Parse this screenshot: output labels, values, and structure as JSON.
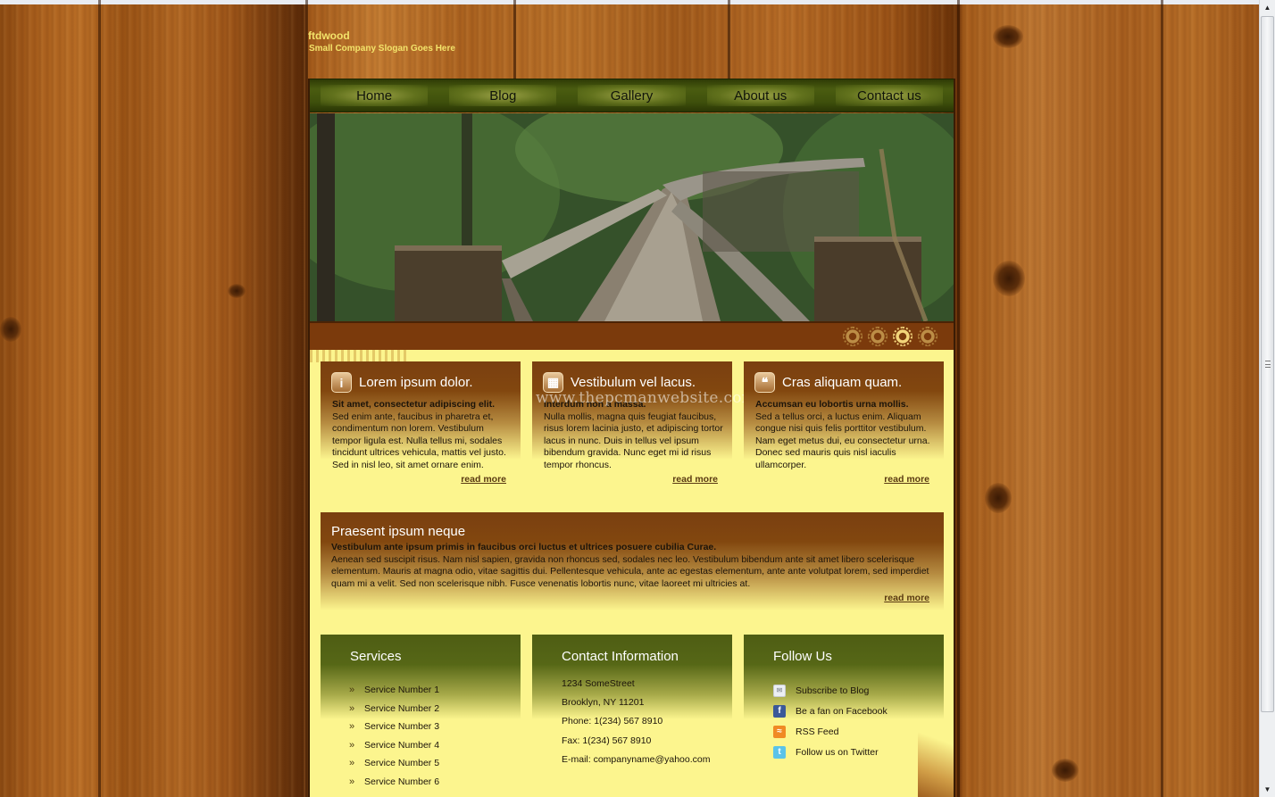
{
  "site": {
    "logo": "ftdwood",
    "slogan": "Small Company Slogan Goes Here"
  },
  "nav": [
    {
      "label": "Home"
    },
    {
      "label": "Blog"
    },
    {
      "label": "Gallery"
    },
    {
      "label": "About us"
    },
    {
      "label": "Contact us"
    }
  ],
  "slider": {
    "slide_count": 4,
    "active_index": 3
  },
  "watermark": "www.thepcmanwebsite.com",
  "features": [
    {
      "icon": "info-icon",
      "title": "Lorem ipsum dolor.",
      "lead": "Sit amet, consectetur adipiscing elit.",
      "text": "Sed enim ante, faucibus in pharetra et, condimentum non lorem. Vestibulum tempor ligula est. Nulla tellus mi, sodales tincidunt ultrices vehicula, mattis vel justo. Sed in nisl leo, sit amet ornare enim.",
      "link": "read more"
    },
    {
      "icon": "document-icon",
      "title": "Vestibulum vel lacus.",
      "lead": "Interdum non a massa.",
      "text": "Nulla mollis, magna quis feugiat faucibus, risus lorem lacinia justo, et adipiscing tortor lacus in nunc. Duis in tellus vel ipsum bibendum gravida. Nunc eget mi id risus tempor rhoncus.",
      "link": "read more"
    },
    {
      "icon": "chat-bubbles-icon",
      "title": "Cras aliquam quam.",
      "lead": "Accumsan eu lobortis urna mollis.",
      "text": "Sed a tellus orci, a luctus enim. Aliquam congue nisi quis felis porttitor vestibulum. Nam eget metus dui, eu consectetur urna. Donec sed mauris quis nisl iaculis ullamcorper.",
      "link": "read more"
    }
  ],
  "wide": {
    "title": "Praesent ipsum neque",
    "lead": "Vestibulum ante ipsum primis in faucibus orci luctus et ultrices posuere cubilia Curae.",
    "text": "Aenean sed suscipit risus. Nam nisl sapien, gravida non rhoncus sed, sodales nec leo. Vestibulum bibendum ante sit amet libero scelerisque elementum. Mauris at magna odio, vitae sagittis dui. Pellentesque vehicula, ante ac egestas elementum, ante ante volutpat lorem, sed imperdiet quam mi a velit. Sed non scelerisque nibh. Fusce venenatis lobortis nunc, vitae laoreet mi ultricies at.",
    "link": "read more"
  },
  "services": {
    "title": "Services",
    "bullet": "»",
    "items": [
      "Service Number 1",
      "Service Number 2",
      "Service Number 3",
      "Service Number 4",
      "Service Number 5",
      "Service Number 6"
    ]
  },
  "contact": {
    "title": "Contact Information",
    "lines": [
      "1234 SomeStreet",
      "Brooklyn, NY 11201",
      "Phone: 1(234) 567 8910",
      "Fax: 1(234) 567 8910",
      "E-mail: companyname@yahoo.com"
    ]
  },
  "follow": {
    "title": "Follow Us",
    "items": [
      {
        "icon": "mail-icon",
        "label": "Subscribe to Blog"
      },
      {
        "icon": "facebook-icon",
        "label": "Be a fan on Facebook"
      },
      {
        "icon": "rss-icon",
        "label": "RSS Feed"
      },
      {
        "icon": "twitter-icon",
        "label": "Follow us on Twitter"
      }
    ]
  },
  "colors": {
    "nav_bg": "#3f500c",
    "content_bg": "#fcf58e",
    "feature_head": "#7a3f10",
    "footer_head": "#4e5d14",
    "slider_bar": "#7b3a0c",
    "logo_text": "#f3e36a"
  }
}
